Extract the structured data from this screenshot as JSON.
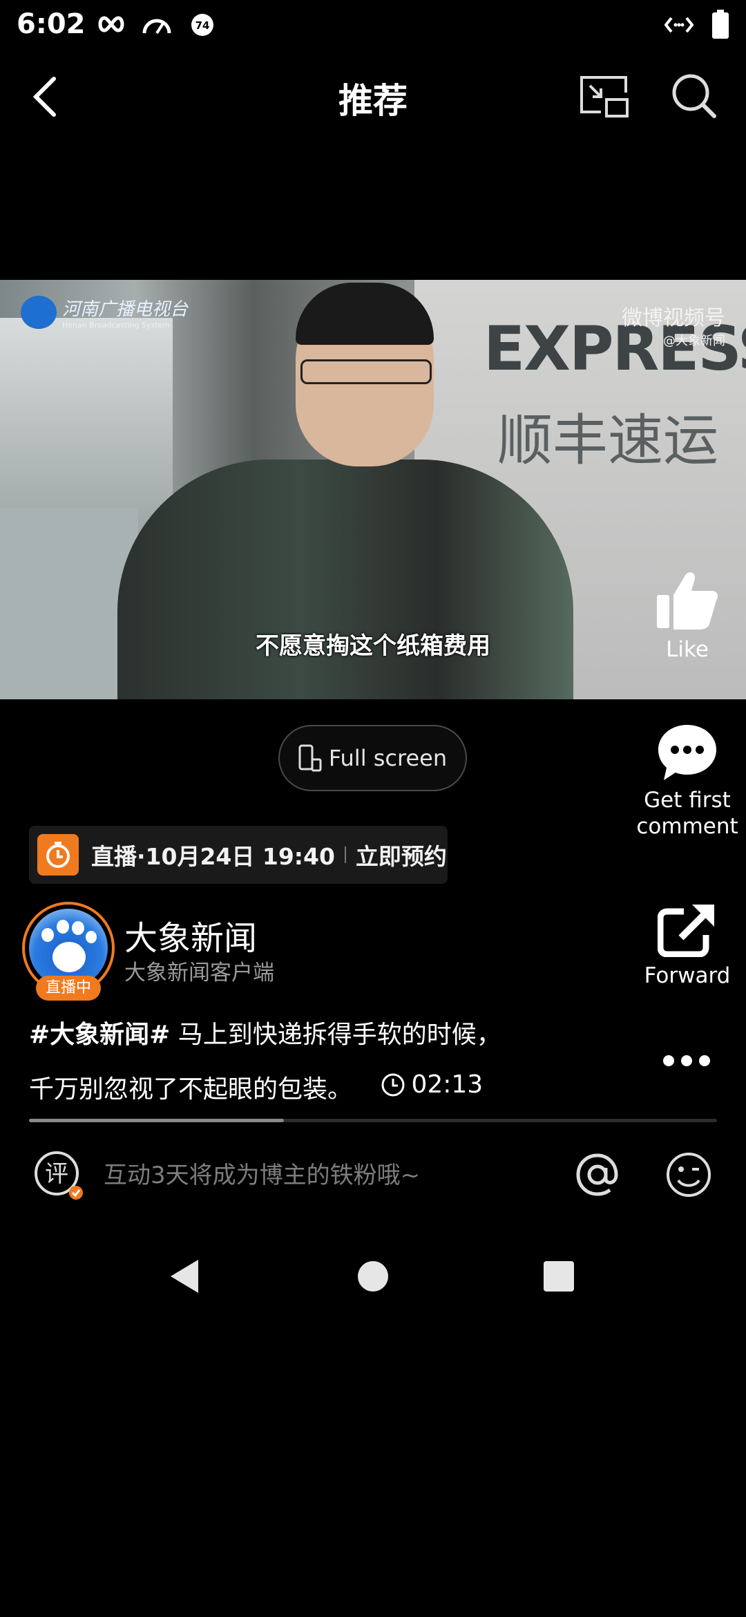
{
  "status_bar": {
    "time": "6:02",
    "icons": [
      "infinity-icon",
      "speedometer-icon",
      "notification-74-icon",
      "data-arrows-icon",
      "battery-icon"
    ],
    "badge_number": "74"
  },
  "nav": {
    "title": "推荐",
    "icons": [
      "back-arrow-icon",
      "picture-in-picture-icon",
      "search-icon"
    ]
  },
  "video": {
    "channel_logo_cn": "河南广播电视台",
    "channel_logo_en": "Henan Broadcasting System",
    "watermark": "微博视频号",
    "watermark_sub": "@大象新闻",
    "background_text_en": "EXPRESS",
    "background_text_cn": "顺丰速运",
    "subtitle": "不愿意掏这个纸箱费用"
  },
  "actions": {
    "like_label": "Like",
    "comment_label_line1": "Get first",
    "comment_label_line2": "comment",
    "forward_label": "Forward",
    "more_icon": "more-dots-icon"
  },
  "fullscreen": {
    "label": "Full screen",
    "icon": "phone-rotate-icon"
  },
  "live": {
    "text": "直播·10月24日 19:40",
    "action": "立即预约",
    "accent": "#f07a1f"
  },
  "author": {
    "name": "大象新闻",
    "subtitle": "大象新闻客户端",
    "live_tag": "直播中"
  },
  "description": {
    "hashtag": "#大象新闻#",
    "text_line1": " 马上到快递拆得手软的时候，",
    "text_line2": "千万别忽视了不起眼的包装。",
    "duration": "02:13"
  },
  "progress": {
    "fraction": 0.37
  },
  "comment_bar": {
    "badge_char": "评",
    "placeholder": "互动3天将成为博主的铁粉哦~",
    "icons": [
      "comment-badge-icon",
      "at-icon",
      "emoji-icon"
    ]
  },
  "system_nav": {
    "icons": [
      "sys-back-icon",
      "sys-home-icon",
      "sys-recent-icon"
    ]
  }
}
